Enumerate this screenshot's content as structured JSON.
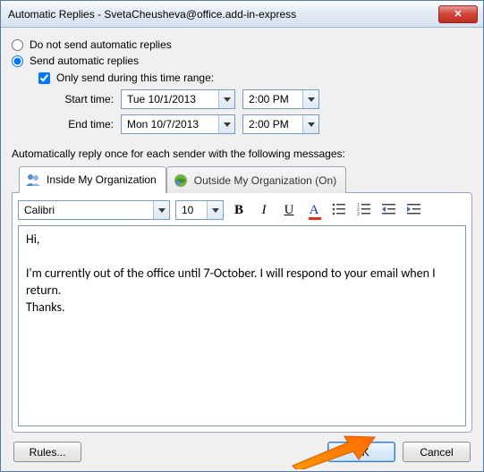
{
  "window": {
    "title": "Automatic Replies - SvetaCheusheva@office.add-in-express"
  },
  "options": {
    "do_not_send_label": "Do not send automatic replies",
    "send_label": "Send automatic replies",
    "only_send_range_label": "Only send during this time range:",
    "start_label": "Start time:",
    "end_label": "End time:",
    "start_date": "Tue 10/1/2013",
    "start_time": "2:00 PM",
    "end_date": "Mon 10/7/2013",
    "end_time": "2:00 PM"
  },
  "section_label": "Automatically reply once for each sender with the following messages:",
  "tabs": {
    "inside": "Inside My Organization",
    "outside": "Outside My Organization (On)"
  },
  "toolbar": {
    "font": "Calibri",
    "size": "10"
  },
  "message_body": "Hi,\n\nI'm currently out of the office until 7-October. I will respond to your email when I return.\nThanks.",
  "buttons": {
    "rules": "Rules...",
    "ok": "OK",
    "cancel": "Cancel"
  }
}
